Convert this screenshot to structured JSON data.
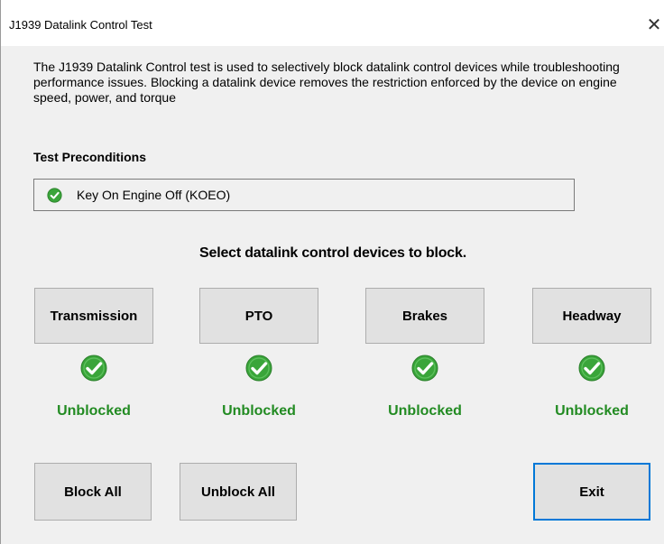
{
  "window": {
    "title": "J1939 Datalink Control Test",
    "close_glyph": "✕"
  },
  "description": "The J1939 Datalink Control test is used to selectively block datalink control devices while troubleshooting performance issues. Blocking a datalink device removes the restriction enforced by the device on engine speed, power, and torque",
  "preconditions": {
    "heading": "Test Preconditions",
    "items": [
      {
        "label": "Key On Engine Off (KOEO)",
        "icon": "check-circle-icon",
        "status_color": "#3aa53a"
      }
    ]
  },
  "devices": {
    "heading": "Select datalink control devices to block.",
    "items": [
      {
        "label": "Transmission",
        "status": "Unblocked",
        "icon": "check-circle-icon"
      },
      {
        "label": "PTO",
        "status": "Unblocked",
        "icon": "check-circle-icon"
      },
      {
        "label": "Brakes",
        "status": "Unblocked",
        "icon": "check-circle-icon"
      },
      {
        "label": "Headway",
        "status": "Unblocked",
        "icon": "check-circle-icon"
      }
    ],
    "status_color": "#228b22"
  },
  "actions": {
    "block_all": "Block All",
    "unblock_all": "Unblock All",
    "exit": "Exit"
  },
  "colors": {
    "accent": "#0078d7",
    "check_green": "#3aa53a"
  }
}
